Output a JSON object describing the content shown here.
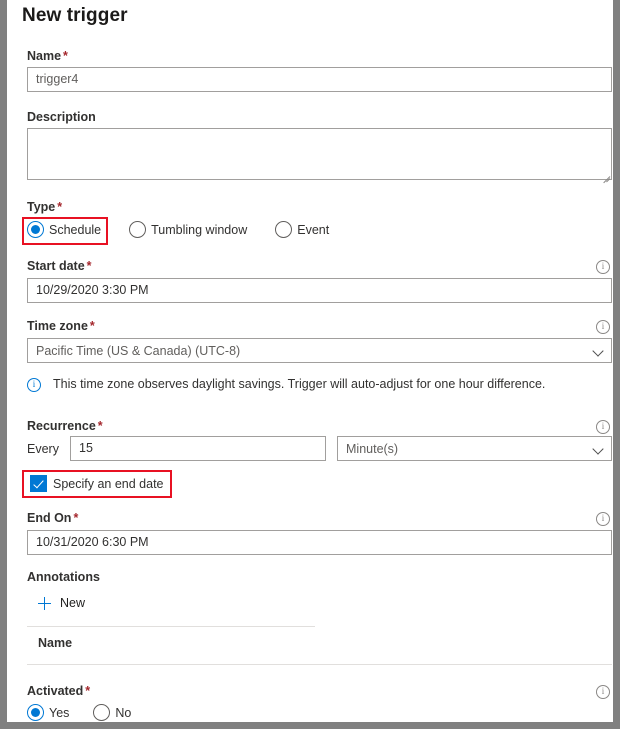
{
  "panel": {
    "title": "New trigger"
  },
  "fields": {
    "name": {
      "label": "Name",
      "required": "*",
      "value": "trigger4"
    },
    "description": {
      "label": "Description",
      "value": ""
    },
    "type": {
      "label": "Type",
      "required": "*",
      "options": [
        {
          "label": "Schedule",
          "selected": true
        },
        {
          "label": "Tumbling window",
          "selected": false
        },
        {
          "label": "Event",
          "selected": false
        }
      ]
    },
    "start_date": {
      "label": "Start date",
      "required": "*",
      "value": "10/29/2020 3:30 PM",
      "info_icon": "info-icon"
    },
    "time_zone": {
      "label": "Time zone",
      "required": "*",
      "value": "Pacific Time (US & Canada) (UTC-8)",
      "chevron": "chevron-down-icon",
      "info_icon": "info-icon"
    },
    "timezone_note": {
      "icon": "info-icon",
      "text": "This time zone observes daylight savings. Trigger will auto-adjust for one hour difference."
    },
    "recurrence": {
      "label": "Recurrence",
      "required": "*",
      "every_label": "Every",
      "interval_value": "15",
      "unit_value": "Minute(s)",
      "info_icon": "info-icon"
    },
    "specify_end_date": {
      "label": "Specify an end date",
      "checked": true
    },
    "end_on": {
      "label": "End On",
      "required": "*",
      "value": "10/31/2020 6:30 PM",
      "info_icon": "info-icon"
    },
    "annotations": {
      "label": "Annotations",
      "new_label": "New",
      "new_icon": "plus-icon",
      "column_header": "Name"
    },
    "activated": {
      "label": "Activated",
      "required": "*",
      "info_icon": "info-icon",
      "options": [
        {
          "label": "Yes",
          "selected": true
        },
        {
          "label": "No",
          "selected": false
        }
      ]
    }
  },
  "colors": {
    "accent": "#0078d4",
    "highlight": "#e81123",
    "required": "#a4262c",
    "frame": "#808080"
  }
}
